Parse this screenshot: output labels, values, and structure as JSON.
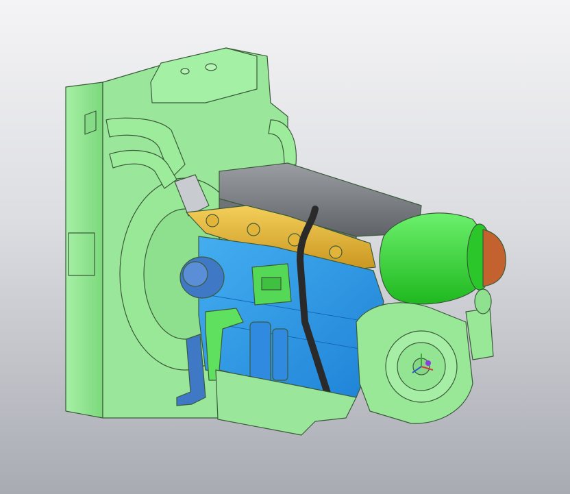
{
  "viewport": {
    "background_top": "#f4f4f6",
    "background_bottom": "#a9abb3"
  },
  "model": {
    "description_visible_text": "",
    "colors": {
      "radiator": "#8fe88f",
      "engine_block": "#2f9be8",
      "valve_cover": "#7d8186",
      "exhaust_manifold": "#e8b73a",
      "air_filter": "#3ddc3d",
      "air_filter_cap": "#c4622f",
      "turbo": "#8fe88f",
      "starter": "#3f78c4",
      "hose": "#2a2a2a",
      "ecu": "#55d855",
      "flywheel_housing": "#8fe88f",
      "pulley_highlight": "#8b3fe0"
    }
  },
  "axis_triad": {
    "x_color": "#d23a3a",
    "y_color": "#3aa83a",
    "z_color": "#2a5ad2"
  }
}
